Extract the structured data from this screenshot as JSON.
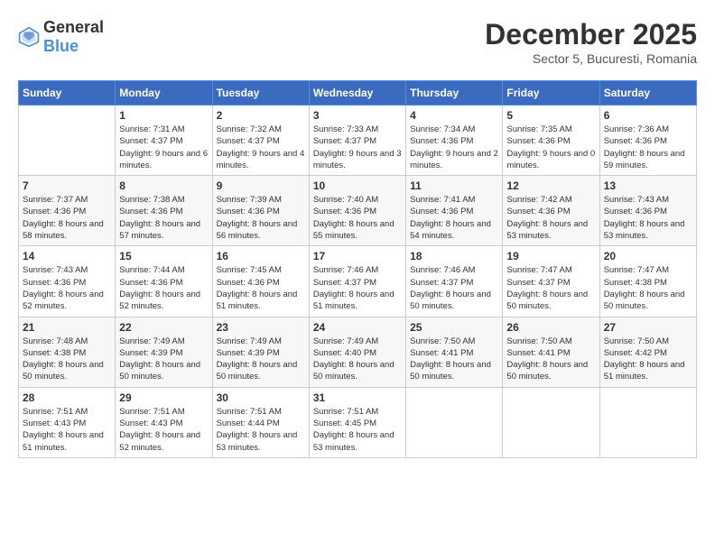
{
  "logo": {
    "general": "General",
    "blue": "Blue"
  },
  "header": {
    "month": "December 2025",
    "subtitle": "Sector 5, Bucuresti, Romania"
  },
  "days_of_week": [
    "Sunday",
    "Monday",
    "Tuesday",
    "Wednesday",
    "Thursday",
    "Friday",
    "Saturday"
  ],
  "weeks": [
    [
      {
        "day": "",
        "sunrise": "",
        "sunset": "",
        "daylight": ""
      },
      {
        "day": "1",
        "sunrise": "Sunrise: 7:31 AM",
        "sunset": "Sunset: 4:37 PM",
        "daylight": "Daylight: 9 hours and 6 minutes."
      },
      {
        "day": "2",
        "sunrise": "Sunrise: 7:32 AM",
        "sunset": "Sunset: 4:37 PM",
        "daylight": "Daylight: 9 hours and 4 minutes."
      },
      {
        "day": "3",
        "sunrise": "Sunrise: 7:33 AM",
        "sunset": "Sunset: 4:37 PM",
        "daylight": "Daylight: 9 hours and 3 minutes."
      },
      {
        "day": "4",
        "sunrise": "Sunrise: 7:34 AM",
        "sunset": "Sunset: 4:36 PM",
        "daylight": "Daylight: 9 hours and 2 minutes."
      },
      {
        "day": "5",
        "sunrise": "Sunrise: 7:35 AM",
        "sunset": "Sunset: 4:36 PM",
        "daylight": "Daylight: 9 hours and 0 minutes."
      },
      {
        "day": "6",
        "sunrise": "Sunrise: 7:36 AM",
        "sunset": "Sunset: 4:36 PM",
        "daylight": "Daylight: 8 hours and 59 minutes."
      }
    ],
    [
      {
        "day": "7",
        "sunrise": "Sunrise: 7:37 AM",
        "sunset": "Sunset: 4:36 PM",
        "daylight": "Daylight: 8 hours and 58 minutes."
      },
      {
        "day": "8",
        "sunrise": "Sunrise: 7:38 AM",
        "sunset": "Sunset: 4:36 PM",
        "daylight": "Daylight: 8 hours and 57 minutes."
      },
      {
        "day": "9",
        "sunrise": "Sunrise: 7:39 AM",
        "sunset": "Sunset: 4:36 PM",
        "daylight": "Daylight: 8 hours and 56 minutes."
      },
      {
        "day": "10",
        "sunrise": "Sunrise: 7:40 AM",
        "sunset": "Sunset: 4:36 PM",
        "daylight": "Daylight: 8 hours and 55 minutes."
      },
      {
        "day": "11",
        "sunrise": "Sunrise: 7:41 AM",
        "sunset": "Sunset: 4:36 PM",
        "daylight": "Daylight: 8 hours and 54 minutes."
      },
      {
        "day": "12",
        "sunrise": "Sunrise: 7:42 AM",
        "sunset": "Sunset: 4:36 PM",
        "daylight": "Daylight: 8 hours and 53 minutes."
      },
      {
        "day": "13",
        "sunrise": "Sunrise: 7:43 AM",
        "sunset": "Sunset: 4:36 PM",
        "daylight": "Daylight: 8 hours and 53 minutes."
      }
    ],
    [
      {
        "day": "14",
        "sunrise": "Sunrise: 7:43 AM",
        "sunset": "Sunset: 4:36 PM",
        "daylight": "Daylight: 8 hours and 52 minutes."
      },
      {
        "day": "15",
        "sunrise": "Sunrise: 7:44 AM",
        "sunset": "Sunset: 4:36 PM",
        "daylight": "Daylight: 8 hours and 52 minutes."
      },
      {
        "day": "16",
        "sunrise": "Sunrise: 7:45 AM",
        "sunset": "Sunset: 4:36 PM",
        "daylight": "Daylight: 8 hours and 51 minutes."
      },
      {
        "day": "17",
        "sunrise": "Sunrise: 7:46 AM",
        "sunset": "Sunset: 4:37 PM",
        "daylight": "Daylight: 8 hours and 51 minutes."
      },
      {
        "day": "18",
        "sunrise": "Sunrise: 7:46 AM",
        "sunset": "Sunset: 4:37 PM",
        "daylight": "Daylight: 8 hours and 50 minutes."
      },
      {
        "day": "19",
        "sunrise": "Sunrise: 7:47 AM",
        "sunset": "Sunset: 4:37 PM",
        "daylight": "Daylight: 8 hours and 50 minutes."
      },
      {
        "day": "20",
        "sunrise": "Sunrise: 7:47 AM",
        "sunset": "Sunset: 4:38 PM",
        "daylight": "Daylight: 8 hours and 50 minutes."
      }
    ],
    [
      {
        "day": "21",
        "sunrise": "Sunrise: 7:48 AM",
        "sunset": "Sunset: 4:38 PM",
        "daylight": "Daylight: 8 hours and 50 minutes."
      },
      {
        "day": "22",
        "sunrise": "Sunrise: 7:49 AM",
        "sunset": "Sunset: 4:39 PM",
        "daylight": "Daylight: 8 hours and 50 minutes."
      },
      {
        "day": "23",
        "sunrise": "Sunrise: 7:49 AM",
        "sunset": "Sunset: 4:39 PM",
        "daylight": "Daylight: 8 hours and 50 minutes."
      },
      {
        "day": "24",
        "sunrise": "Sunrise: 7:49 AM",
        "sunset": "Sunset: 4:40 PM",
        "daylight": "Daylight: 8 hours and 50 minutes."
      },
      {
        "day": "25",
        "sunrise": "Sunrise: 7:50 AM",
        "sunset": "Sunset: 4:41 PM",
        "daylight": "Daylight: 8 hours and 50 minutes."
      },
      {
        "day": "26",
        "sunrise": "Sunrise: 7:50 AM",
        "sunset": "Sunset: 4:41 PM",
        "daylight": "Daylight: 8 hours and 50 minutes."
      },
      {
        "day": "27",
        "sunrise": "Sunrise: 7:50 AM",
        "sunset": "Sunset: 4:42 PM",
        "daylight": "Daylight: 8 hours and 51 minutes."
      }
    ],
    [
      {
        "day": "28",
        "sunrise": "Sunrise: 7:51 AM",
        "sunset": "Sunset: 4:43 PM",
        "daylight": "Daylight: 8 hours and 51 minutes."
      },
      {
        "day": "29",
        "sunrise": "Sunrise: 7:51 AM",
        "sunset": "Sunset: 4:43 PM",
        "daylight": "Daylight: 8 hours and 52 minutes."
      },
      {
        "day": "30",
        "sunrise": "Sunrise: 7:51 AM",
        "sunset": "Sunset: 4:44 PM",
        "daylight": "Daylight: 8 hours and 53 minutes."
      },
      {
        "day": "31",
        "sunrise": "Sunrise: 7:51 AM",
        "sunset": "Sunset: 4:45 PM",
        "daylight": "Daylight: 8 hours and 53 minutes."
      },
      {
        "day": "",
        "sunrise": "",
        "sunset": "",
        "daylight": ""
      },
      {
        "day": "",
        "sunrise": "",
        "sunset": "",
        "daylight": ""
      },
      {
        "day": "",
        "sunrise": "",
        "sunset": "",
        "daylight": ""
      }
    ]
  ]
}
